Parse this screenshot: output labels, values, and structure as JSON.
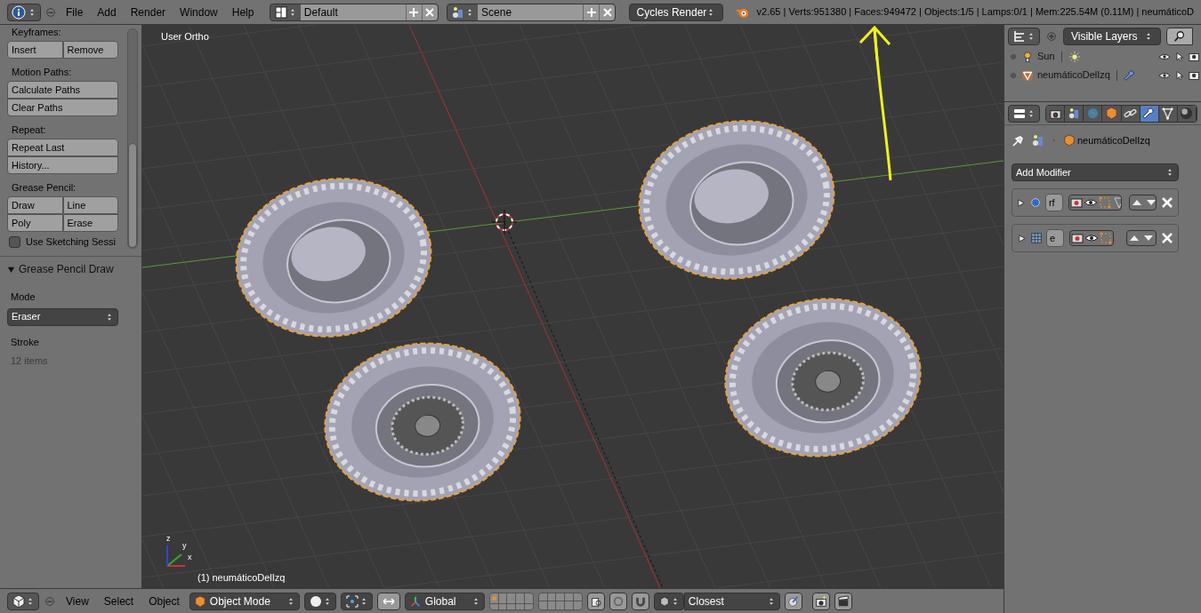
{
  "header": {
    "menus": [
      "File",
      "Add",
      "Render",
      "Window",
      "Help"
    ],
    "layout": "Default",
    "scene": "Scene",
    "render_engine": "Cycles Render",
    "stats": "v2.65 | Verts:951380 | Faces:949472 | Objects:1/5 | Lamps:0/1 | Mem:225.54M (0.11M) | neumáticoD"
  },
  "tool_shelf": {
    "sections": [
      {
        "title": "Keyframes:",
        "rows": [
          [
            "Insert",
            "Remove"
          ]
        ]
      },
      {
        "title": "Motion Paths:",
        "rows": [
          [
            "Calculate Paths"
          ],
          [
            "Clear Paths"
          ]
        ]
      },
      {
        "title": "Repeat:",
        "rows": [
          [
            "Repeat Last"
          ],
          [
            "History..."
          ]
        ]
      },
      {
        "title": "Grease Pencil:",
        "rows": [
          [
            "Draw",
            "Line"
          ],
          [
            "Poly",
            "Erase"
          ]
        ]
      }
    ],
    "checkbox": {
      "label": "Use Sketching Sessi",
      "checked": false
    },
    "panel": {
      "title": "Grease Pencil Draw",
      "expanded": true,
      "mode_label": "Mode",
      "mode": "Eraser",
      "stroke_label": "Stroke",
      "stroke_info": "12 items"
    }
  },
  "viewport": {
    "view_label": "User Ortho",
    "object_label": "(1) neumáticoDelIzq",
    "axes": [
      "x",
      "y",
      "z"
    ]
  },
  "outliner": {
    "filter": "Visible Layers",
    "items": [
      {
        "name": "Sun",
        "kind": "lamp",
        "selected": false
      },
      {
        "name": "neumáticoDelIzq",
        "kind": "mesh",
        "selected": false
      }
    ]
  },
  "properties": {
    "tabs": [
      {
        "kind": "render",
        "selected": false
      },
      {
        "kind": "scene",
        "selected": false
      },
      {
        "kind": "world",
        "selected": false
      },
      {
        "kind": "object",
        "selected": false
      },
      {
        "kind": "constraints",
        "selected": false
      },
      {
        "kind": "modifiers",
        "selected": true
      },
      {
        "kind": "data",
        "selected": false
      },
      {
        "kind": "material",
        "selected": false
      }
    ],
    "object_name": "neumáticoDelIzq",
    "add_modifier": "Add Modifier",
    "modifiers": [
      {
        "name": "rf",
        "kind": "sphere",
        "expanded": false
      },
      {
        "name": "e",
        "kind": "grid",
        "expanded": false
      }
    ]
  },
  "footer": {
    "menus": [
      "View",
      "Select",
      "Object"
    ],
    "mode": "Object Mode",
    "orientation": "Global",
    "snap_target": "Closest"
  }
}
